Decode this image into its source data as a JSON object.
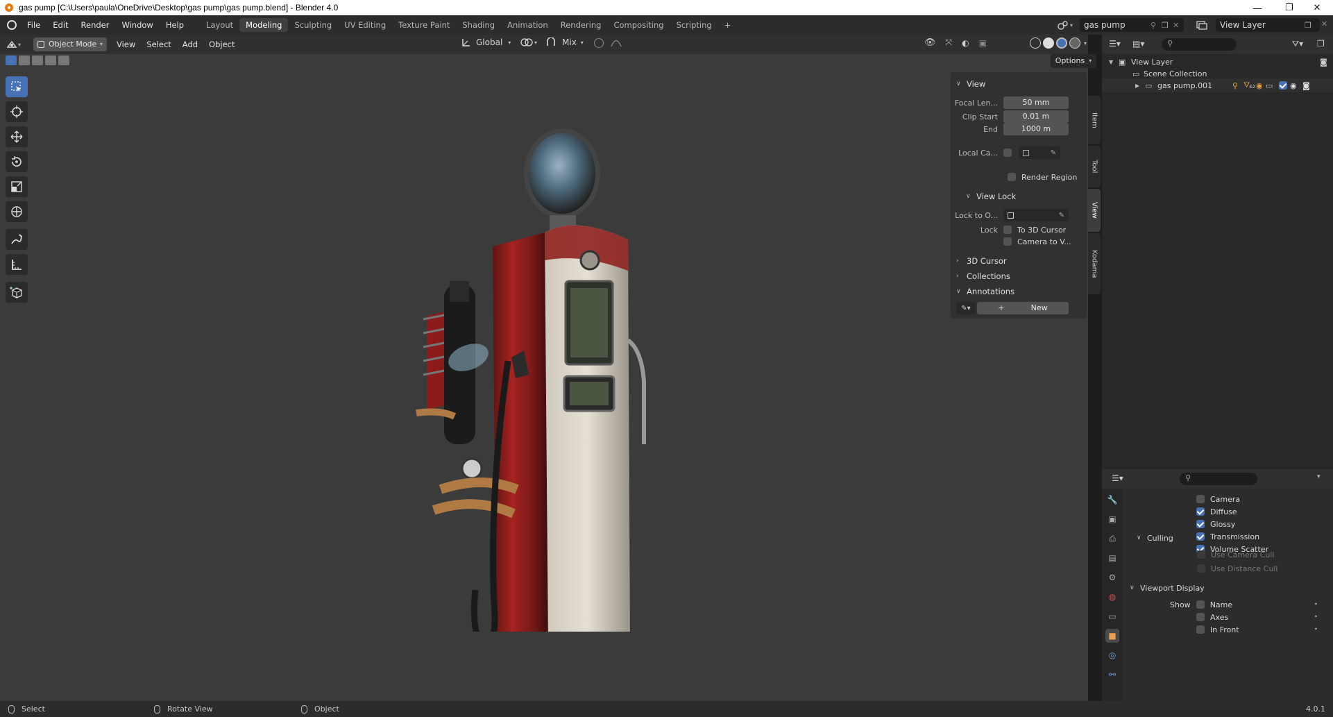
{
  "window": {
    "title": "gas pump [C:\\Users\\paula\\OneDrive\\Desktop\\gas pump\\gas pump.blend] - Blender 4.0",
    "controls": [
      "—",
      "❐",
      "✕"
    ]
  },
  "menu": [
    "File",
    "Edit",
    "Render",
    "Window",
    "Help"
  ],
  "workspaces": [
    {
      "label": "Layout",
      "active": false
    },
    {
      "label": "Modeling",
      "active": true
    },
    {
      "label": "Sculpting",
      "active": false
    },
    {
      "label": "UV Editing",
      "active": false
    },
    {
      "label": "Texture Paint",
      "active": false
    },
    {
      "label": "Shading",
      "active": false
    },
    {
      "label": "Animation",
      "active": false
    },
    {
      "label": "Rendering",
      "active": false
    },
    {
      "label": "Compositing",
      "active": false
    },
    {
      "label": "Scripting",
      "active": false
    }
  ],
  "add_workspace_label": "+",
  "scene_name": "gas pump",
  "view_layer_name": "View Layer",
  "viewport": {
    "mode": "Object Mode",
    "menus": [
      "View",
      "Select",
      "Add",
      "Object"
    ],
    "transform_orientation": "Global",
    "snap_mode": "Mix",
    "options_label": "Options",
    "tools": [
      "select-box",
      "cursor",
      "move",
      "rotate",
      "scale",
      "transform",
      "annotate",
      "measure",
      "add-cube"
    ]
  },
  "npanel": {
    "tabs": [
      "Item",
      "Tool",
      "View",
      "Kodama"
    ],
    "active_tab": "View",
    "view_header": "View",
    "focal_length_label": "Focal Len...",
    "focal_length_value": "50 mm",
    "clip_start_label": "Clip Start",
    "clip_start_value": "0.01 m",
    "clip_end_label": "End",
    "clip_end_value": "1000 m",
    "local_camera_label": "Local Ca...",
    "render_region_label": "Render Region",
    "view_lock_header": "View Lock",
    "lock_to_object_label": "Lock to O...",
    "lock_label": "Lock",
    "to_3d_cursor_label": "To 3D Cursor",
    "camera_to_view_label": "Camera to V...",
    "cursor_section": "3D Cursor",
    "collections_section": "Collections",
    "annotations_section": "Annotations",
    "new_button": "New"
  },
  "outliner": {
    "view_layer": "View Layer",
    "scene_collection": "Scene Collection",
    "object_name": "gas pump.001",
    "badge_count": "42"
  },
  "properties": {
    "ray_visibility": [
      {
        "label": "Camera",
        "checked": false
      },
      {
        "label": "Diffuse",
        "checked": true
      },
      {
        "label": "Glossy",
        "checked": true
      },
      {
        "label": "Transmission",
        "checked": true
      },
      {
        "label": "Volume Scatter",
        "checked": true
      }
    ],
    "culling_header": "Culling",
    "use_camera_cull": "Use Camera Cull",
    "use_distance_cull": "Use Distance Cull",
    "viewport_display_header": "Viewport Display",
    "show_label": "Show",
    "show_items": [
      "Name",
      "Axes",
      "In Front"
    ]
  },
  "statusbar": {
    "select": "Select",
    "rotate_view": "Rotate View",
    "object": "Object",
    "version": "4.0.1"
  },
  "colors": {
    "accent": "#4772b3",
    "background": "#3b3b3b",
    "header": "#303030",
    "active_object_orange": "#f0a050"
  }
}
